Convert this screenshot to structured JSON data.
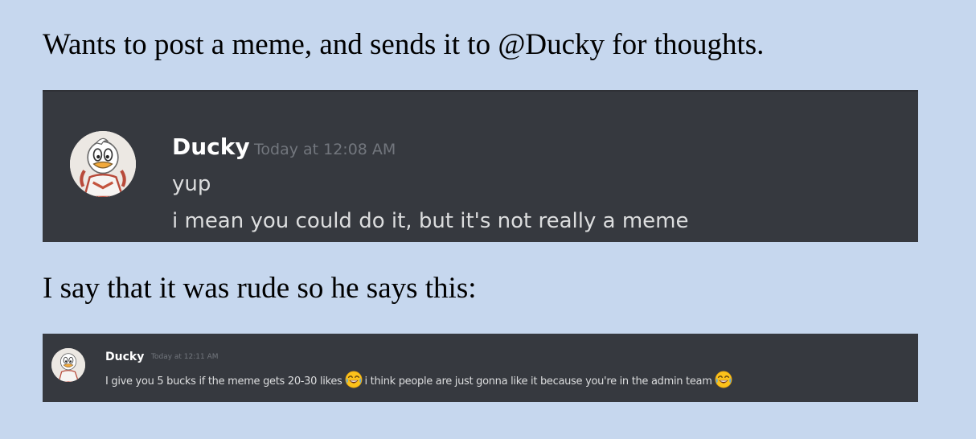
{
  "captions": {
    "top": "Wants to post a meme, and sends it to @Ducky for thoughts.",
    "middle": "I say that it was rude so he says this:"
  },
  "message1": {
    "username": "Ducky",
    "timestamp": "Today at 12:08 AM",
    "lines": [
      "yup",
      "i mean you could do it, but it's not really a meme"
    ]
  },
  "message2": {
    "username": "Ducky",
    "timestamp": "Today at 12:11 AM",
    "text_part1": "I give you 5 bucks if the meme gets 20-30 likes",
    "text_part2": "i think people are just gonna like it because you're in the admin team",
    "emoji": "joy-emoji"
  },
  "colors": {
    "page_background": "#c6d7ee",
    "chat_background": "#36393f",
    "username": "#ffffff",
    "message_text": "#dcddde",
    "timestamp": "#72767d"
  }
}
